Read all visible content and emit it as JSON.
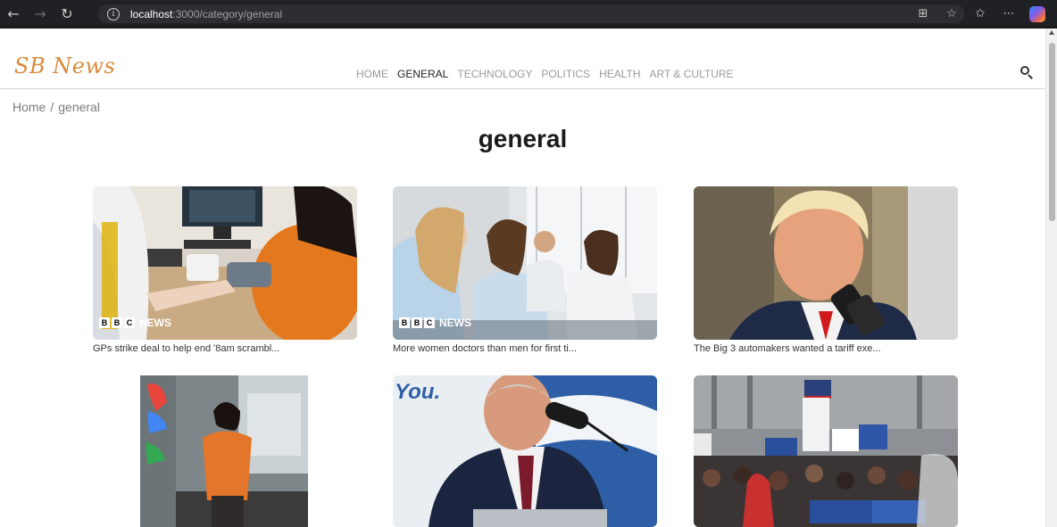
{
  "browser": {
    "url_host": "localhost",
    "url_path": ":3000/category/general",
    "icons": [
      "back-icon",
      "forward-icon",
      "reload-icon",
      "info-icon",
      "split-screen-icon",
      "favorite-star-icon",
      "favorites-icon",
      "more-icon",
      "copilot-icon"
    ]
  },
  "site": {
    "logo": "SB News",
    "nav": [
      {
        "label": "HOME",
        "active": false
      },
      {
        "label": "GENERAL",
        "active": true
      },
      {
        "label": "TECHNOLOGY",
        "active": false
      },
      {
        "label": "POLITICS",
        "active": false
      },
      {
        "label": "HEALTH",
        "active": false
      },
      {
        "label": "ART & CULTURE",
        "active": false
      }
    ],
    "accent": "#d98a3a"
  },
  "breadcrumb": {
    "home": "Home",
    "separator": "/",
    "current": "general"
  },
  "page_title": "general",
  "cards": [
    {
      "caption": "GPs strike deal to help end '8am scrambl...",
      "badge": "NEWS"
    },
    {
      "caption": "More women doctors than men for first ti...",
      "badge": "NEWS"
    },
    {
      "caption": "The Big 3 automakers wanted a tariff exe..."
    },
    {
      "caption": ""
    },
    {
      "caption": "",
      "image_text": "You."
    },
    {
      "caption": ""
    }
  ]
}
